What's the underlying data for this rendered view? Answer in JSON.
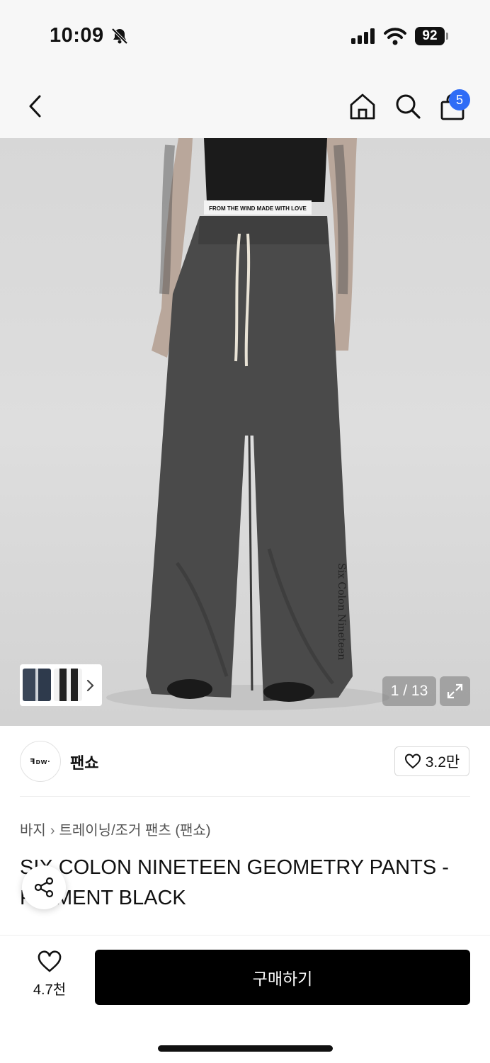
{
  "status": {
    "time": "10:09",
    "battery": "92"
  },
  "nav": {
    "cart_count": "5"
  },
  "gallery": {
    "counter": "1 / 13",
    "print": "FROM THE WIND MADE WITH LOVE",
    "leg_text": "Six Colon Nineteen"
  },
  "brand": {
    "logo_text": "ꟻᴅᴡ·",
    "name": "팬쇼",
    "likes": "3.2만"
  },
  "breadcrumb": [
    "바지",
    "트레이닝/조거 팬츠 (팬쇼)"
  ],
  "product": {
    "title": "SIX COLON NINETEEN GEOMETRY PANTS - PIGMENT BLACK"
  },
  "bottom": {
    "fav_count": "4.7천",
    "buy_label": "구매하기"
  },
  "colors": {
    "accent": "#2f6cf6",
    "buy_bg": "#000000",
    "pants": "#4a4a4a"
  }
}
